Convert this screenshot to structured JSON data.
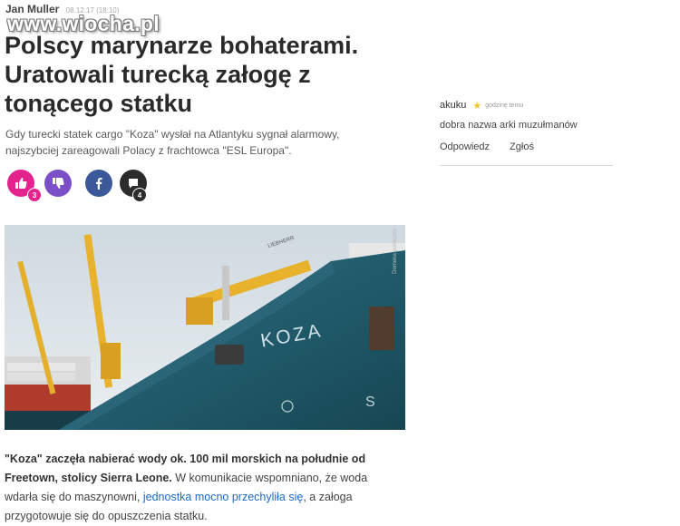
{
  "post": {
    "author": "Jan Muller",
    "date": "08.12.17 (18:10)",
    "watermark": "www.wiocha.pl"
  },
  "article": {
    "title": "Polscy marynarze bohaterami. Uratowali turecką załogę z tonącego statku",
    "lead": "Gdy turecki statek cargo \"Koza\" wysłał na Atlantyku sygnał alarmowy, najszybciej zareagowali Polacy z frachtowca \"ESL Europa\".",
    "photo_credit": "Domena publiczna",
    "ship_name": "KOZA",
    "crane_brand": "LIEBHERR",
    "body_bold": "\"Koza\" zaczęła nabierać wody ok. 100 mil morskich na południe od Freetown, stolicy Sierra Leone.",
    "body_text_1": " W komunikacie wspomniano, że woda wdarła się do maszynowni, ",
    "body_link": "jednostka mocno przechyliła się",
    "body_text_2": ", a załoga przygotowuje się do opuszczenia statku."
  },
  "reactions": {
    "like_count": "3",
    "comment_count": "4",
    "icons": [
      "thumbs-up-icon",
      "thumbs-down-icon",
      "facebook-icon",
      "comment-icon"
    ],
    "colors": {
      "like": "#e5238e",
      "dislike": "#7b4fc8",
      "facebook": "#3b5998",
      "comment": "#2c2c2c"
    }
  },
  "comment": {
    "user": "akuku",
    "time": "godzinę temu",
    "text": "dobra nazwa arki muzułmanów",
    "reply_label": "Odpowiedz",
    "report_label": "Zgłoś"
  }
}
